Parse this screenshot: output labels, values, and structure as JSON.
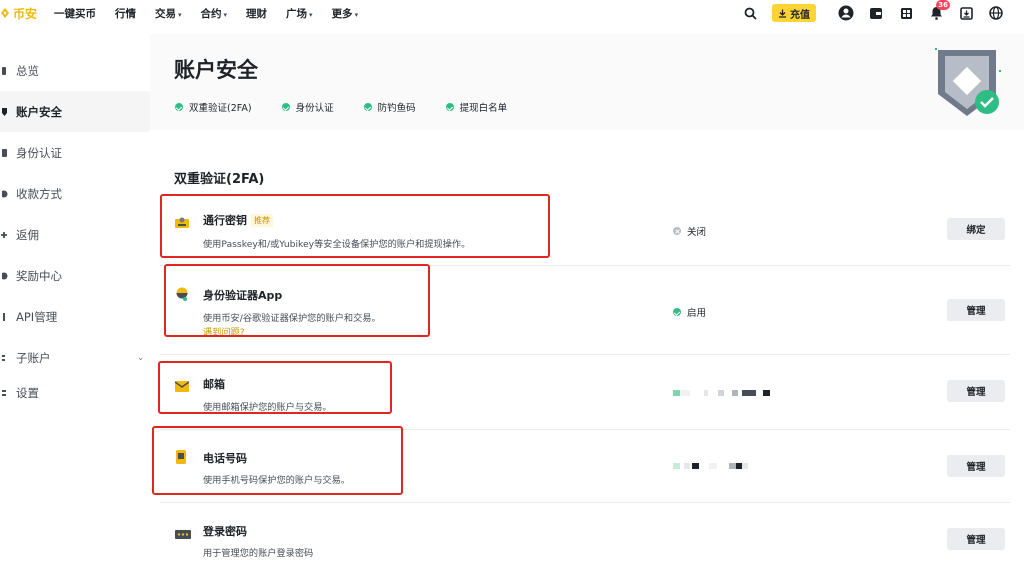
{
  "nav": {
    "brand": "币安",
    "items": [
      {
        "label": "一键买币",
        "caret": false
      },
      {
        "label": "行情",
        "caret": false
      },
      {
        "label": "交易",
        "caret": true
      },
      {
        "label": "合约",
        "caret": true
      },
      {
        "label": "理财",
        "caret": false
      },
      {
        "label": "广场",
        "caret": true
      },
      {
        "label": "更多",
        "caret": true
      }
    ],
    "deposit_label": "充值",
    "notification_count": "36"
  },
  "sidebar": {
    "items": [
      {
        "label": "总览",
        "icon": "overview-icon"
      },
      {
        "label": "账户安全",
        "icon": "security-icon",
        "active": true
      },
      {
        "label": "身份认证",
        "icon": "identity-icon"
      },
      {
        "label": "收款方式",
        "icon": "payment-icon"
      },
      {
        "label": "返佣",
        "icon": "referral-icon"
      },
      {
        "label": "奖励中心",
        "icon": "reward-icon"
      },
      {
        "label": "API管理",
        "icon": "api-icon"
      },
      {
        "label": "子账户",
        "icon": "subaccount-icon",
        "expandable": true
      },
      {
        "label": "设置",
        "icon": "settings-icon"
      }
    ]
  },
  "header": {
    "title": "账户安全",
    "steps": [
      "双重验证(2FA)",
      "身份认证",
      "防钓鱼码",
      "提现白名单"
    ]
  },
  "section": {
    "title": "双重验证(2FA)",
    "rows": [
      {
        "title": "通行密钥",
        "tag": "推荐",
        "desc": "使用Passkey和/或Yubikey等安全设备保护您的账户和提现操作。",
        "status": "关闭",
        "button": "绑定"
      },
      {
        "title": "身份验证器App",
        "desc": "使用币安/谷歌验证器保护您的账户和交易。",
        "link": "遇到问题?",
        "status": "启用",
        "button": "管理"
      },
      {
        "title": "邮箱",
        "desc": "使用邮箱保护您的账户与交易。",
        "button": "管理"
      },
      {
        "title": "电话号码",
        "desc": "使用手机号码保护您的账户与交易。",
        "button": "管理"
      },
      {
        "title": "登录密码",
        "desc": "用于管理您的账户登录密码",
        "button": "管理"
      }
    ]
  },
  "colors": {
    "brand": "#f0b90b",
    "success": "#2ebd85",
    "highlight_box": "#e0261f"
  }
}
